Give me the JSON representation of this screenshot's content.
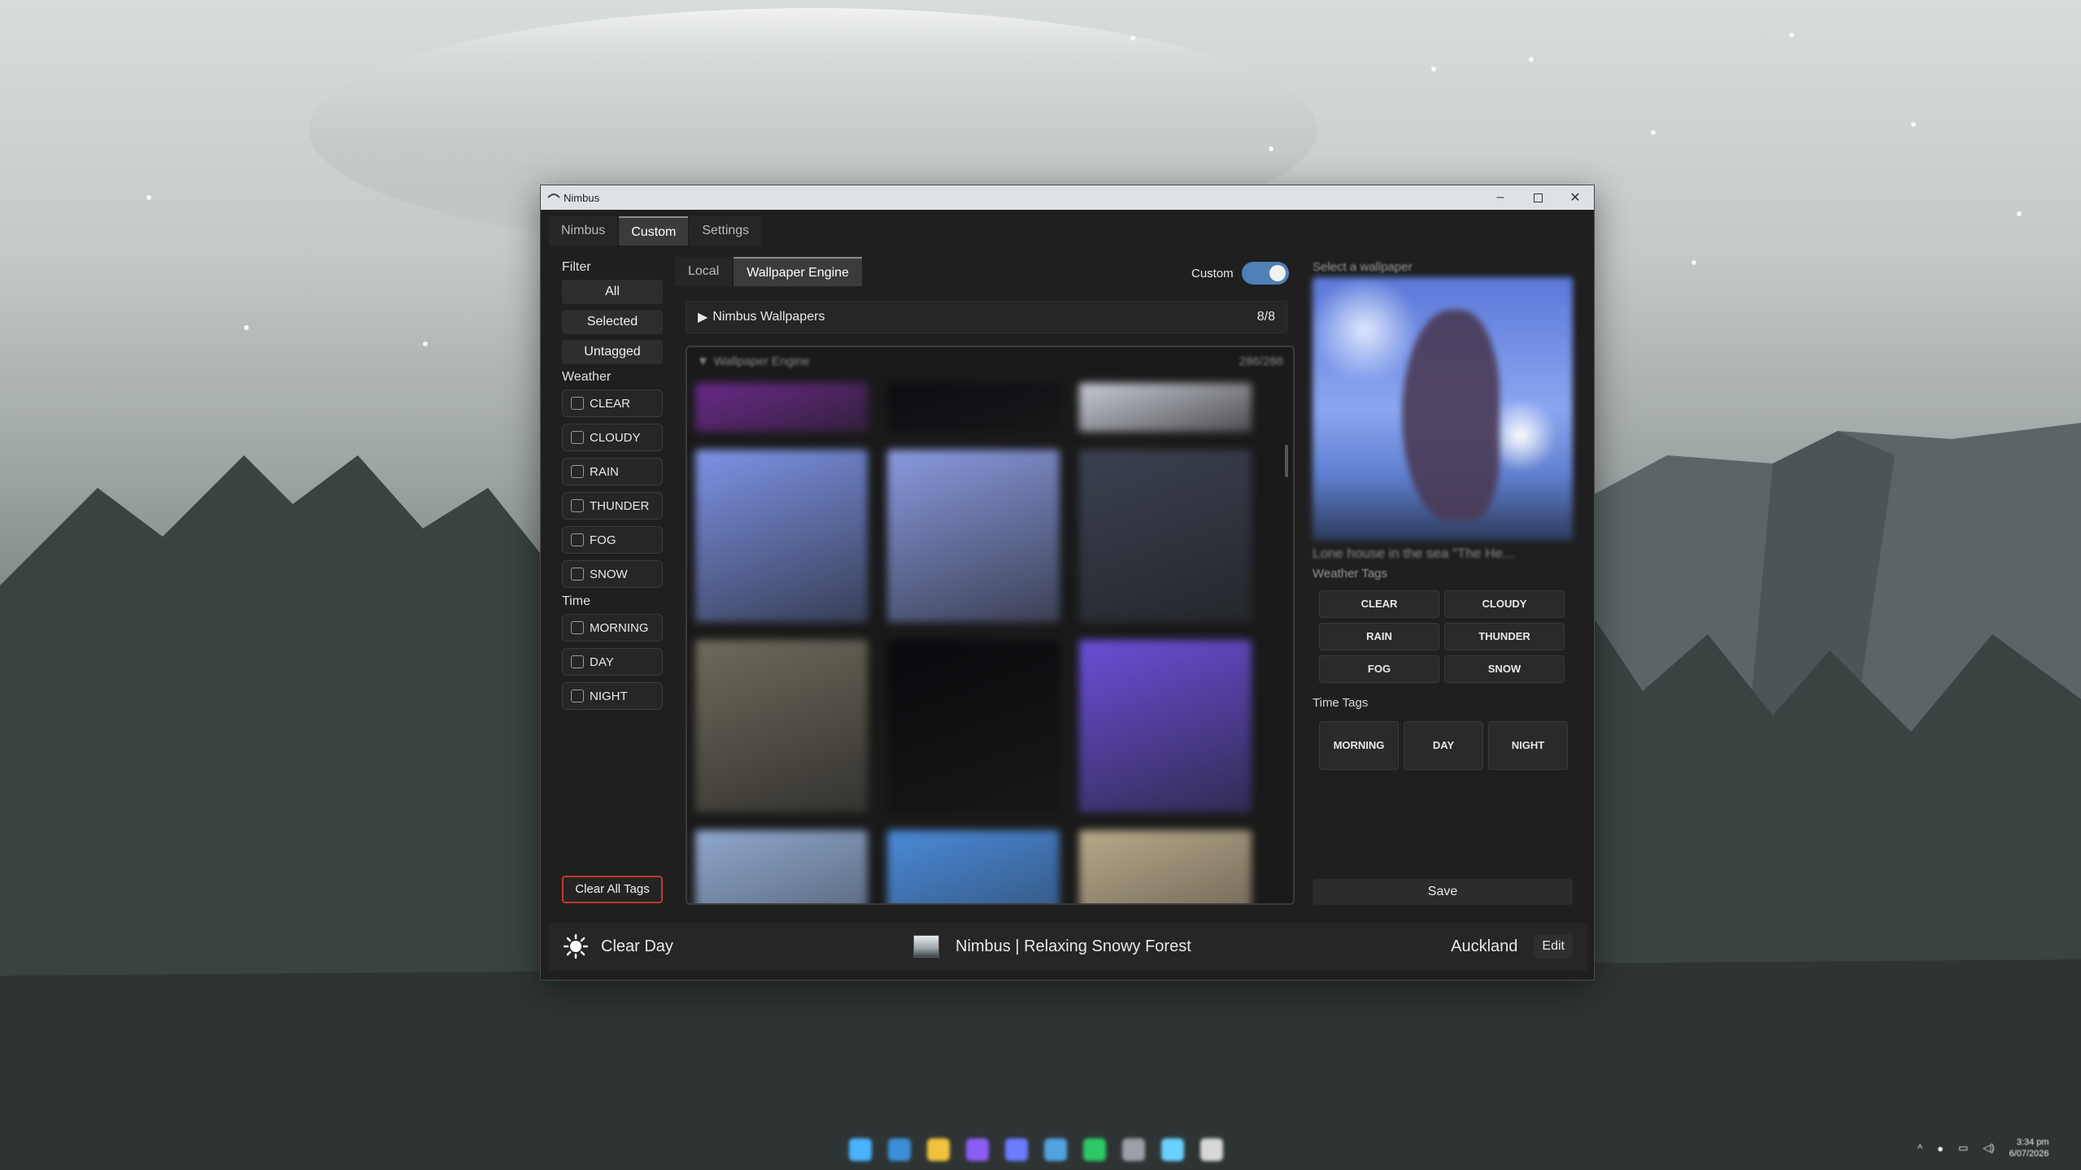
{
  "window": {
    "title": "Nimbus"
  },
  "main_tabs": [
    {
      "label": "Nimbus"
    },
    {
      "label": "Custom"
    },
    {
      "label": "Settings"
    }
  ],
  "filter": {
    "heading": "Filter",
    "buttons": [
      "All",
      "Selected",
      "Untagged"
    ],
    "weather_heading": "Weather",
    "weather": [
      "CLEAR",
      "CLOUDY",
      "RAIN",
      "THUNDER",
      "FOG",
      "SNOW"
    ],
    "time_heading": "Time",
    "time": [
      "MORNING",
      "DAY",
      "NIGHT"
    ],
    "clear_all_label": "Clear All Tags"
  },
  "center": {
    "sub_tabs": [
      "Local",
      "Wallpaper Engine"
    ],
    "custom_label": "Custom",
    "custom_enabled": true,
    "groups": [
      {
        "label": "Nimbus Wallpapers",
        "count": "8/8",
        "expanded": false
      },
      {
        "label": "Wallpaper Engine",
        "count": "286/286",
        "expanded": true
      }
    ],
    "tile_colors": [
      "#6a2a8a",
      "#0c0c12",
      "#c9ccd6",
      "#7d93e6",
      "#8a9ae0",
      "#3a4150",
      "#6e6a5c",
      "#0a0a0e",
      "#6a4fd8",
      "#8fa8cf",
      "#4a8ad8",
      "#b8a98a"
    ]
  },
  "right": {
    "select_label": "Select a wallpaper",
    "wallpaper_name": "Lone house in the sea \"The He...",
    "weather_tags_label": "Weather Tags",
    "weather_tags": [
      "CLEAR",
      "CLOUDY",
      "RAIN",
      "THUNDER",
      "FOG",
      "SNOW"
    ],
    "time_tags_label": "Time Tags",
    "time_tags": [
      "MORNING",
      "DAY",
      "NIGHT"
    ],
    "save_label": "Save"
  },
  "status": {
    "weather_icon": "sun-icon",
    "weather_text": "Clear Day",
    "now_playing": "Nimbus | Relaxing Snowy Forest",
    "location": "Auckland",
    "edit_label": "Edit"
  },
  "tray": {
    "time": "3:34 pm",
    "date": "6/07/2026"
  },
  "taskbar_icons": [
    "windows-icon",
    "file-explorer-icon",
    "folder-icon",
    "app-purple-icon",
    "discord-icon",
    "telegram-icon",
    "spotify-icon",
    "settings-icon",
    "nimbus-icon",
    "app-icon"
  ],
  "accent_colors": {
    "toggle": "#4f80b5",
    "clear_all_border": "#c0392b"
  }
}
